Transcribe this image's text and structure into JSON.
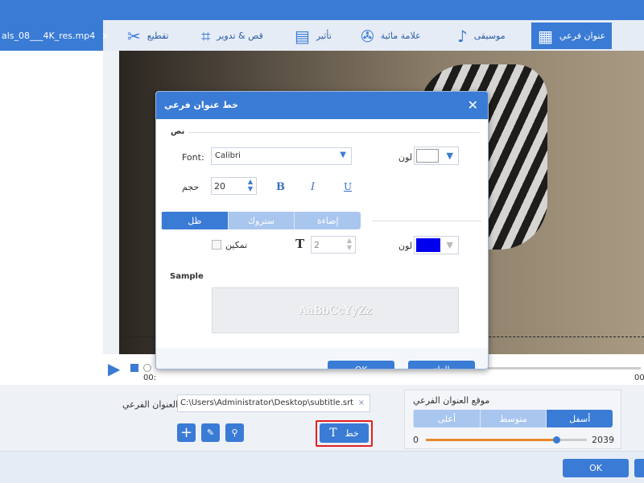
{
  "file_tab": {
    "name": "als_08___4K_res.mp4",
    "close": "×"
  },
  "tabs": [
    {
      "label": "عنوان فرعي",
      "icon": "subtitle-icon",
      "active": true
    },
    {
      "label": "موسيقى",
      "icon": "music-note-icon"
    },
    {
      "label": "علامة مائية",
      "icon": "watermark-icon"
    },
    {
      "label": "تأثير",
      "icon": "effect-film-icon"
    },
    {
      "label": "قص & تدوير",
      "icon": "crop-rotate-icon"
    },
    {
      "label": "تقطيع",
      "icon": "cut-scissors-icon"
    }
  ],
  "player": {
    "time_left": "00:",
    "time_right": "00"
  },
  "dialog": {
    "title": "خط عنوان فرعي",
    "section_text": "نص",
    "font_label": "Font:",
    "font_value": "Calibri",
    "color_label": "لون",
    "text_color": "#ffffff",
    "size_label": "حجم",
    "size_value": "20",
    "bold": "B",
    "italic": "I",
    "underline": "U",
    "effect_tabs": [
      {
        "label": "ظل",
        "active": true
      },
      {
        "label": "ستروك"
      },
      {
        "label": "إضاءة"
      }
    ],
    "enable_label": "تمكين",
    "enable_checked": false,
    "thickness_value": "2",
    "effect_color_label": "لون",
    "effect_color": "#0000ee",
    "sample_label": "Sample",
    "sample_text": "AaBbCcYyZz",
    "ok": "OK",
    "cancel": "إلغاء"
  },
  "subtitle": {
    "label": "العنوان الفرعي",
    "path": "C:\\Users\\Administrator\\Desktop\\subtitle.srt",
    "clear": "×",
    "font_button": "خط",
    "font_button_icon": "T"
  },
  "position": {
    "title": "موقع العنوان الفرعي",
    "options": [
      {
        "label": "أسفل",
        "active": true
      },
      {
        "label": "متوسط"
      },
      {
        "label": "أعلى"
      }
    ],
    "min": "0",
    "max": "2039",
    "slider_fraction": 0.81
  },
  "footer": {
    "ok": "OK"
  },
  "colors": {
    "accent": "#3a7bd5",
    "slider": "#e8892c",
    "highlight": "#e02020"
  }
}
